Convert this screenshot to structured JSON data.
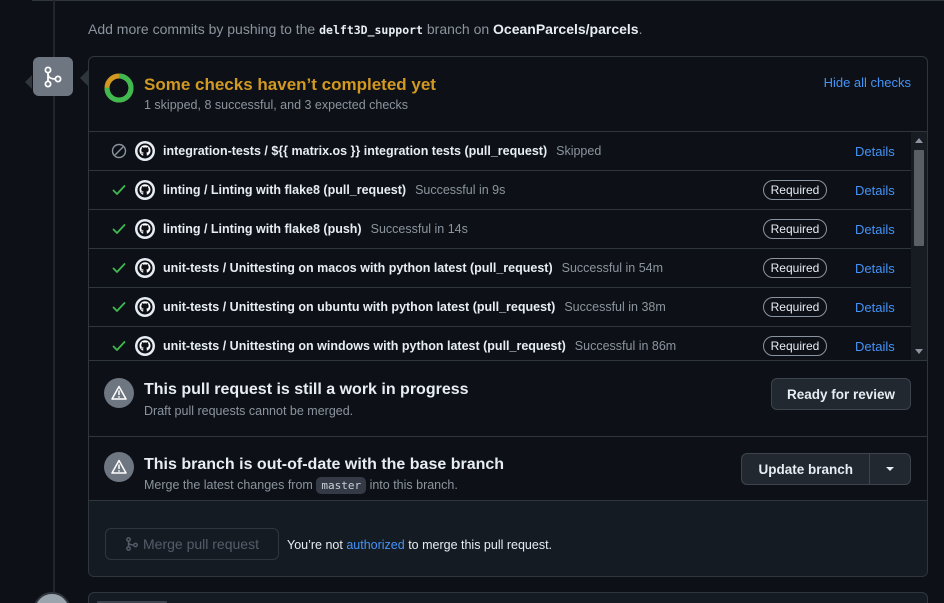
{
  "push_note": {
    "prefix": "Add more commits by pushing to the",
    "branch": "delft3D_support",
    "middle": "branch on",
    "repo": "OceanParcels/parcels",
    "suffix": "."
  },
  "checks": {
    "title": "Some checks haven’t completed yet",
    "summary": "1 skipped, 8 successful, and 3 expected checks",
    "hide_label": "Hide all checks",
    "progress": {
      "skipped": 1,
      "successful": 8,
      "expected": 3
    },
    "rows": [
      {
        "status": "skipped",
        "name": "integration-tests / ${{ matrix.os }} integration tests (pull_request)",
        "result": "Skipped",
        "required": false,
        "required_label": "",
        "details": "Details"
      },
      {
        "status": "success",
        "name": "linting / Linting with flake8 (pull_request)",
        "result": "Successful in 9s",
        "required": true,
        "required_label": "Required",
        "details": "Details"
      },
      {
        "status": "success",
        "name": "linting / Linting with flake8 (push)",
        "result": "Successful in 14s",
        "required": true,
        "required_label": "Required",
        "details": "Details"
      },
      {
        "status": "success",
        "name": "unit-tests / Unittesting on macos with python latest (pull_request)",
        "result": "Successful in 54m",
        "required": true,
        "required_label": "Required",
        "details": "Details"
      },
      {
        "status": "success",
        "name": "unit-tests / Unittesting on ubuntu with python latest (pull_request)",
        "result": "Successful in 38m",
        "required": true,
        "required_label": "Required",
        "details": "Details"
      },
      {
        "status": "success",
        "name": "unit-tests / Unittesting on windows with python latest (pull_request)",
        "result": "Successful in 86m",
        "required": true,
        "required_label": "Required",
        "details": "Details"
      }
    ]
  },
  "draft": {
    "title": "This pull request is still a work in progress",
    "subtitle": "Draft pull requests cannot be merged.",
    "button": "Ready for review"
  },
  "outdated": {
    "title": "This branch is out-of-date with the base branch",
    "subtitle_prefix": "Merge the latest changes from",
    "base_branch": "master",
    "subtitle_suffix": "into this branch.",
    "button": "Update branch"
  },
  "merge": {
    "button": "Merge pull request",
    "msg_prefix": "You’re not",
    "msg_link": "authorized",
    "msg_suffix": "to merge this pull request."
  },
  "colors": {
    "pending": "#d29922",
    "success": "#3fb950",
    "link": "#4493f8",
    "background": "#0d1117"
  }
}
